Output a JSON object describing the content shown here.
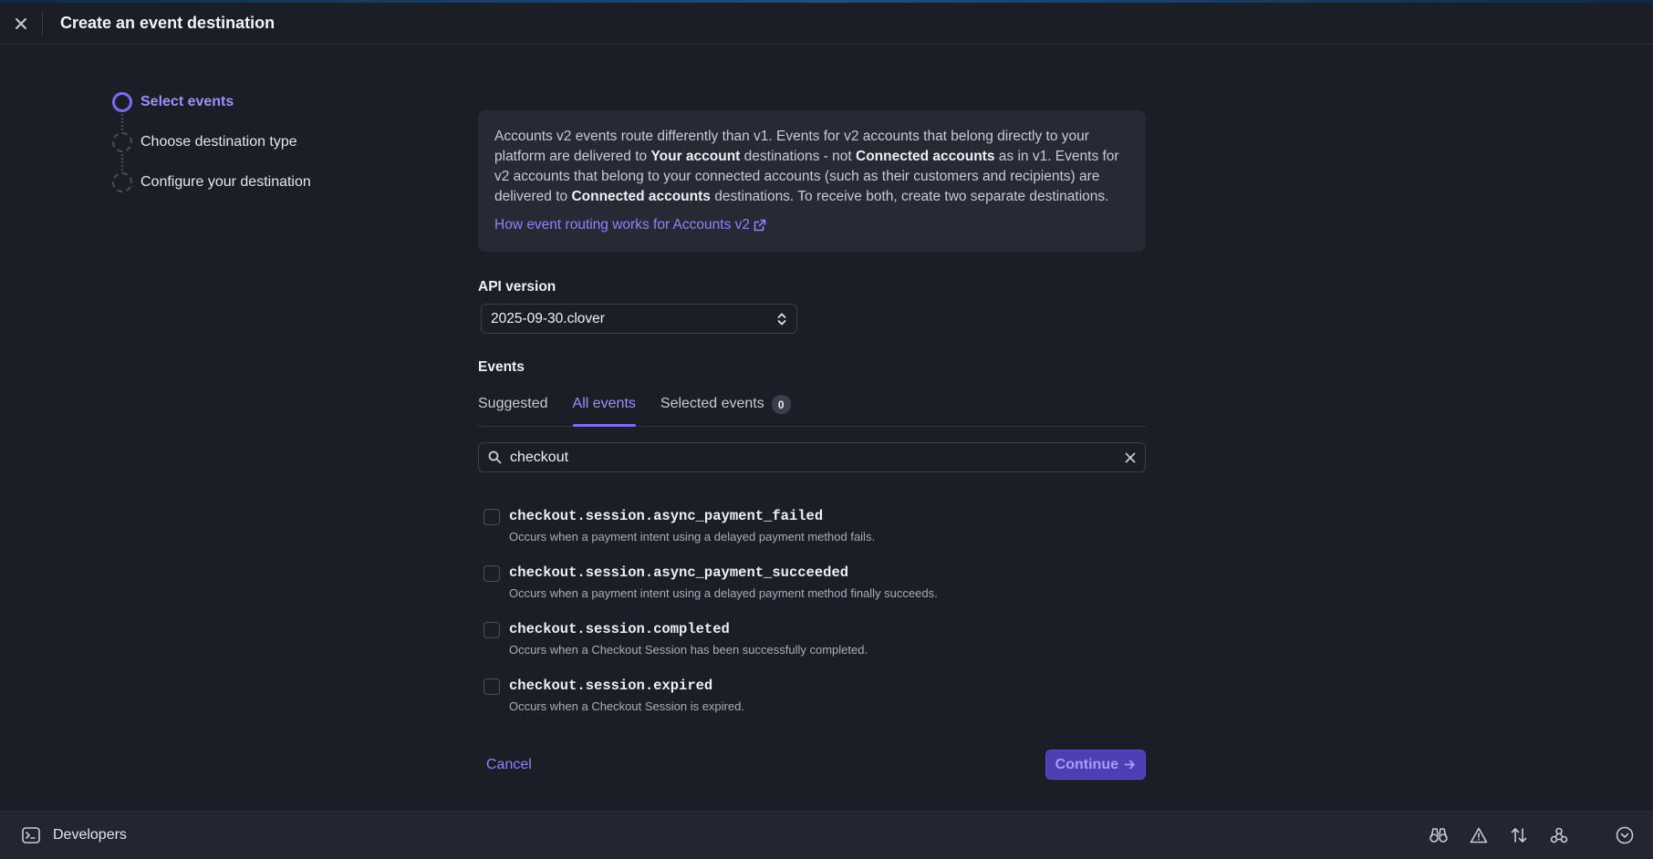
{
  "header": {
    "title": "Create an event destination",
    "close_icon": "close-icon"
  },
  "stepper": {
    "steps": [
      {
        "label": "Select events",
        "active": true
      },
      {
        "label": "Choose destination type",
        "active": false
      },
      {
        "label": "Configure your destination",
        "active": false
      }
    ]
  },
  "info": {
    "p1": "Accounts v2 events route differently than v1. Events for v2 accounts that belong directly to your platform are delivered to ",
    "b1": "Your account",
    "p2": " destinations - not ",
    "b2": "Connected accounts",
    "p3": " as in v1. Events for v2 accounts that belong to your connected accounts (such as their customers and recipients) are delivered to ",
    "b3": "Connected accounts",
    "p4": " destinations. To receive both, create two separate destinations.",
    "link": "How event routing works for Accounts v2",
    "link_icon": "external-link-icon"
  },
  "api": {
    "label": "API version",
    "value": "2025-09-30.clover"
  },
  "events": {
    "label": "Events",
    "tabs": [
      {
        "label": "Suggested",
        "active": false
      },
      {
        "label": "All events",
        "active": true
      },
      {
        "label": "Selected events",
        "active": false,
        "badge": "0"
      }
    ],
    "search": {
      "value": "checkout",
      "placeholder": ""
    },
    "items": [
      {
        "name": "checkout.session.async_payment_failed",
        "desc": "Occurs when a payment intent using a delayed payment method fails."
      },
      {
        "name": "checkout.session.async_payment_succeeded",
        "desc": "Occurs when a payment intent using a delayed payment method finally succeeds."
      },
      {
        "name": "checkout.session.completed",
        "desc": "Occurs when a Checkout Session has been successfully completed."
      },
      {
        "name": "checkout.session.expired",
        "desc": "Occurs when a Checkout Session is expired."
      }
    ]
  },
  "actions": {
    "cancel": "Cancel",
    "continue": "Continue"
  },
  "bottom_bar": {
    "label": "Developers",
    "icons": [
      "binoculars-icon",
      "warning-icon",
      "sort-arrows-icon",
      "webhooks-icon",
      "chevron-down-circle-icon"
    ]
  },
  "colors": {
    "accent": "#7b6cf0",
    "link": "#8f82ff",
    "background": "#1b1e27",
    "panel": "#262a35"
  }
}
